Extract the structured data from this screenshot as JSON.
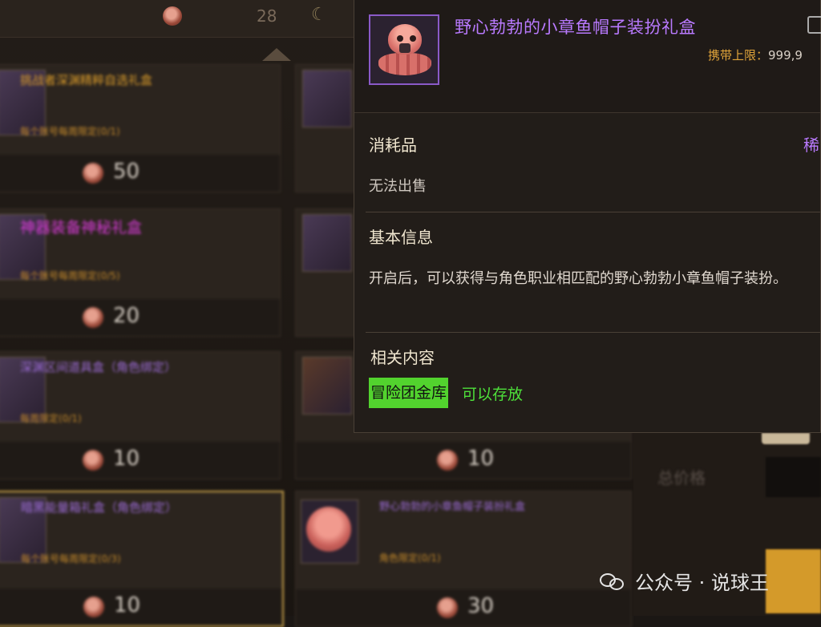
{
  "topbar": {
    "coin_count": "28",
    "moon_icon": "☾"
  },
  "shop_items": [
    {
      "title": "挑战者深渊精粹自选礼盒",
      "limit": "每个账号每周限定(0/1)",
      "price": "50",
      "title_color": "#d89a2a"
    },
    {
      "title": "",
      "limit": "",
      "price": "",
      "title_color": "#d89a2a"
    },
    {
      "title": "神器装备神秘礼盒",
      "limit": "每个账号每周限定(0/5)",
      "price": "20",
      "title_color": "#d43ad4"
    },
    {
      "title": "",
      "limit": "",
      "price": "",
      "title_color": "#d89a2a"
    },
    {
      "title": "深渊区间道具盒（角色绑定）",
      "limit": "每周限定(0/1)",
      "price": "10",
      "title_color": "#9a6ad4"
    },
    {
      "title": "",
      "limit": "",
      "price": "10",
      "title_color": "#d89a2a"
    },
    {
      "title": "暗黑能量箱礼盒（角色绑定）",
      "limit": "每个账号每周限定(0/3)",
      "price": "10",
      "title_color": "#9a6ad4"
    },
    {
      "title": "野心勃勃的小章鱼帽子装扮礼盒",
      "limit": "角色限定(0/1)",
      "price": "30",
      "title_color": "#9a6ad4"
    }
  ],
  "right_panel": {
    "total_label": "总价格"
  },
  "tooltip": {
    "title": "野心勃勃的小章鱼帽子装扮礼盒",
    "carry_label": "携带上限：",
    "carry_value": "999,9",
    "item_type": "消耗品",
    "rarity": "稀",
    "sell_status": "无法出售",
    "basic_info_header": "基本信息",
    "description": "开启后，可以获得与角色职业相匹配的野心勃勃小章鱼帽子装扮。",
    "related_header": "相关内容",
    "related_badge": "冒险团金库",
    "related_note": "可以存放"
  },
  "watermark": {
    "text": "公众号 · 说球王"
  },
  "colors": {
    "tooltip_title": "#b97aff",
    "badge_bg": "#52d32e",
    "storable": "#4ee03a",
    "carry_label": "#e0a43a"
  }
}
